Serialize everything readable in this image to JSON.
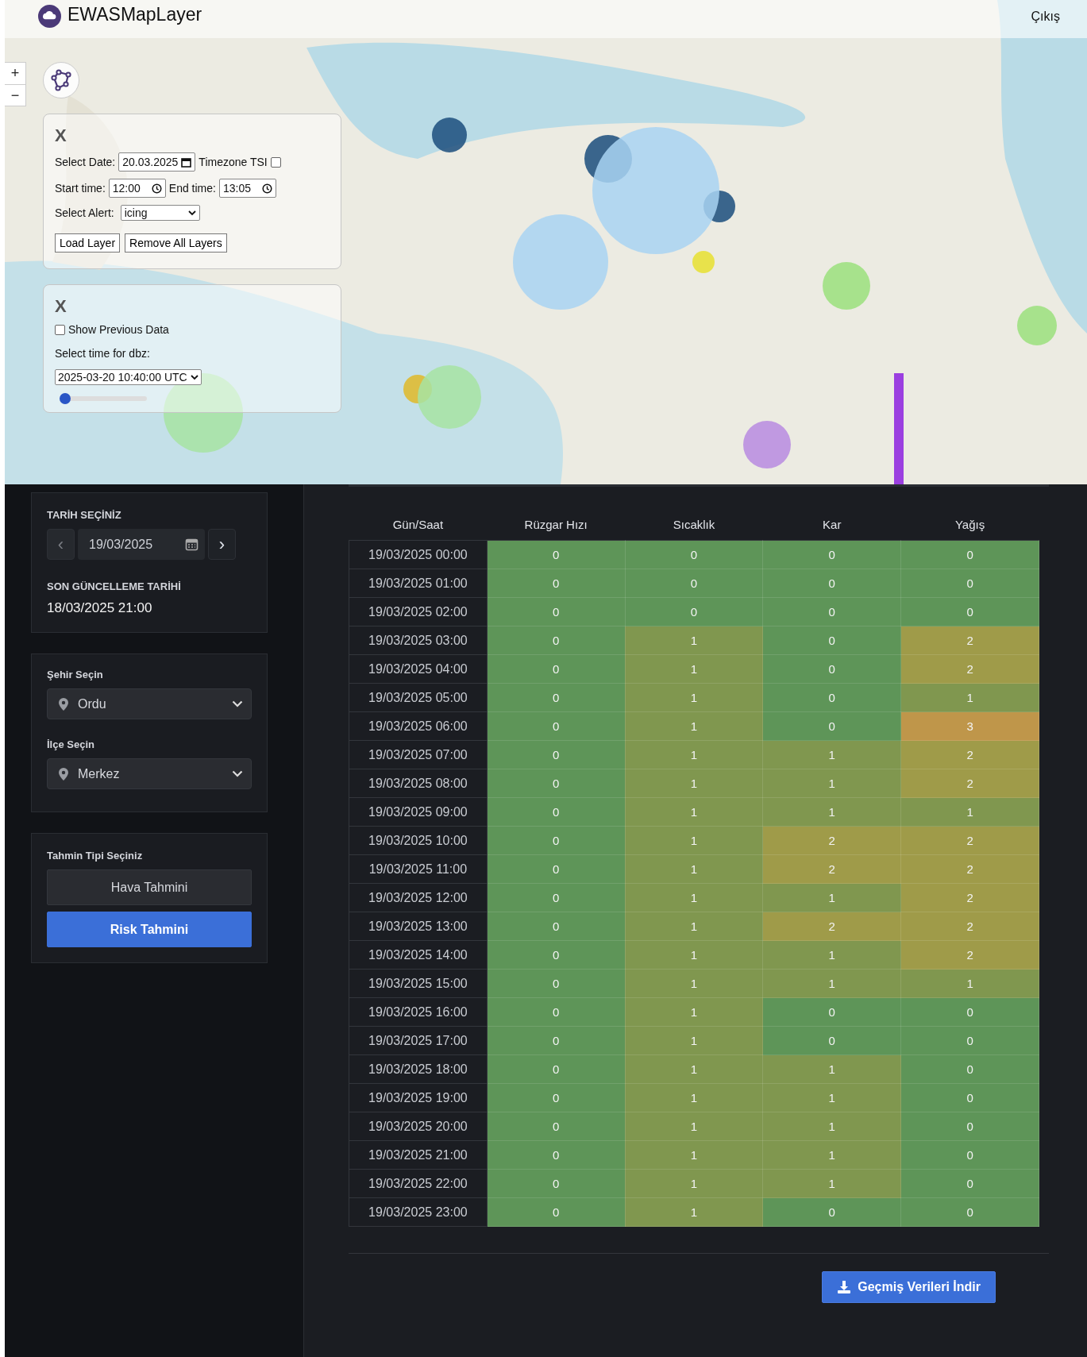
{
  "header": {
    "title": "EWASMapLayer",
    "logout": "Çıkış"
  },
  "map": {
    "kind": "picture",
    "zoom_in": "+",
    "zoom_out": "−"
  },
  "layer_panel": {
    "close": "X",
    "date_label": "Select Date:",
    "date_value": "20.03.2025",
    "timezone_label": "Timezone TSI",
    "timezone_checked": false,
    "start_label": "Start time:",
    "start_value": "12:00",
    "end_label": "End time:",
    "end_value": "13:05",
    "alert_label": "Select Alert:",
    "alert_value": "icing",
    "buttons": [
      "Load Layer",
      "Remove All Layers"
    ]
  },
  "dbz_panel": {
    "close": "X",
    "previous_label": "Show Previous Data",
    "previous_checked": false,
    "time_label": "Select time for dbz:",
    "time_value": "2025-03-20 10:40:00 UTC",
    "level": 0
  },
  "sidebar": {
    "date_title": "TARİH SEÇİNİZ",
    "prev": "‹",
    "date_value": "19/03/2025",
    "next": "›",
    "update_title": "SON GÜNCELLEME TARİHİ",
    "update_value": "18/03/2025 21:00",
    "city_label": "Şehir Seçin",
    "city_value": "Ordu",
    "district_label": "İlçe Seçin",
    "district_value": "Merkez",
    "type_title": "Tahmin Tipi Seçiniz",
    "types": [
      {
        "label": "Hava Tahmini",
        "selected": false
      },
      {
        "label": "Risk Tahmini",
        "selected": true
      }
    ]
  },
  "table": {
    "columns": [
      "Gün/Saat",
      "Rüzgar Hızı",
      "Sıcaklık",
      "Kar",
      "Yağış"
    ],
    "rows": [
      {
        "cells": [
          {
            "value": "19/03/2025 00:00"
          },
          {
            "value": "0",
            "color": "#5e9558"
          },
          {
            "value": "0",
            "color": "#5e9558"
          },
          {
            "value": "0",
            "color": "#5e9558"
          },
          {
            "value": "0",
            "color": "#5e9558"
          }
        ]
      },
      {
        "cells": [
          {
            "value": "19/03/2025 01:00"
          },
          {
            "value": "0",
            "color": "#5e9558"
          },
          {
            "value": "0",
            "color": "#5e9558"
          },
          {
            "value": "0",
            "color": "#5e9558"
          },
          {
            "value": "0",
            "color": "#5e9558"
          }
        ]
      },
      {
        "cells": [
          {
            "value": "19/03/2025 02:00"
          },
          {
            "value": "0",
            "color": "#5e9558"
          },
          {
            "value": "0",
            "color": "#5e9558"
          },
          {
            "value": "0",
            "color": "#5e9558"
          },
          {
            "value": "0",
            "color": "#5e9558"
          }
        ]
      },
      {
        "cells": [
          {
            "value": "19/03/2025 03:00"
          },
          {
            "value": "0",
            "color": "#5e9558"
          },
          {
            "value": "1",
            "color": "#80974f"
          },
          {
            "value": "0",
            "color": "#5e9558"
          },
          {
            "value": "2",
            "color": "#9f9b49"
          }
        ]
      },
      {
        "cells": [
          {
            "value": "19/03/2025 04:00"
          },
          {
            "value": "0",
            "color": "#5e9558"
          },
          {
            "value": "1",
            "color": "#80974f"
          },
          {
            "value": "0",
            "color": "#5e9558"
          },
          {
            "value": "2",
            "color": "#9f9b49"
          }
        ]
      },
      {
        "cells": [
          {
            "value": "19/03/2025 05:00"
          },
          {
            "value": "0",
            "color": "#5e9558"
          },
          {
            "value": "1",
            "color": "#80974f"
          },
          {
            "value": "0",
            "color": "#5e9558"
          },
          {
            "value": "1",
            "color": "#80974f"
          }
        ]
      },
      {
        "cells": [
          {
            "value": "19/03/2025 06:00"
          },
          {
            "value": "0",
            "color": "#5e9558"
          },
          {
            "value": "1",
            "color": "#80974f"
          },
          {
            "value": "0",
            "color": "#5e9558"
          },
          {
            "value": "3",
            "color": "#bf964a"
          }
        ]
      },
      {
        "cells": [
          {
            "value": "19/03/2025 07:00"
          },
          {
            "value": "0",
            "color": "#5e9558"
          },
          {
            "value": "1",
            "color": "#80974f"
          },
          {
            "value": "1",
            "color": "#80974f"
          },
          {
            "value": "2",
            "color": "#9f9b49"
          }
        ]
      },
      {
        "cells": [
          {
            "value": "19/03/2025 08:00"
          },
          {
            "value": "0",
            "color": "#5e9558"
          },
          {
            "value": "1",
            "color": "#80974f"
          },
          {
            "value": "1",
            "color": "#80974f"
          },
          {
            "value": "2",
            "color": "#9f9b49"
          }
        ]
      },
      {
        "cells": [
          {
            "value": "19/03/2025 09:00"
          },
          {
            "value": "0",
            "color": "#5e9558"
          },
          {
            "value": "1",
            "color": "#80974f"
          },
          {
            "value": "1",
            "color": "#80974f"
          },
          {
            "value": "1",
            "color": "#80974f"
          }
        ]
      },
      {
        "cells": [
          {
            "value": "19/03/2025 10:00"
          },
          {
            "value": "0",
            "color": "#5e9558"
          },
          {
            "value": "1",
            "color": "#80974f"
          },
          {
            "value": "2",
            "color": "#9f9b49"
          },
          {
            "value": "2",
            "color": "#9f9b49"
          }
        ]
      },
      {
        "cells": [
          {
            "value": "19/03/2025 11:00"
          },
          {
            "value": "0",
            "color": "#5e9558"
          },
          {
            "value": "1",
            "color": "#80974f"
          },
          {
            "value": "2",
            "color": "#9f9b49"
          },
          {
            "value": "2",
            "color": "#9f9b49"
          }
        ]
      },
      {
        "cells": [
          {
            "value": "19/03/2025 12:00"
          },
          {
            "value": "0",
            "color": "#5e9558"
          },
          {
            "value": "1",
            "color": "#80974f"
          },
          {
            "value": "1",
            "color": "#80974f"
          },
          {
            "value": "2",
            "color": "#9f9b49"
          }
        ]
      },
      {
        "cells": [
          {
            "value": "19/03/2025 13:00"
          },
          {
            "value": "0",
            "color": "#5e9558"
          },
          {
            "value": "1",
            "color": "#80974f"
          },
          {
            "value": "2",
            "color": "#9f9b49"
          },
          {
            "value": "2",
            "color": "#9f9b49"
          }
        ]
      },
      {
        "cells": [
          {
            "value": "19/03/2025 14:00"
          },
          {
            "value": "0",
            "color": "#5e9558"
          },
          {
            "value": "1",
            "color": "#80974f"
          },
          {
            "value": "1",
            "color": "#80974f"
          },
          {
            "value": "2",
            "color": "#9f9b49"
          }
        ]
      },
      {
        "cells": [
          {
            "value": "19/03/2025 15:00"
          },
          {
            "value": "0",
            "color": "#5e9558"
          },
          {
            "value": "1",
            "color": "#80974f"
          },
          {
            "value": "1",
            "color": "#80974f"
          },
          {
            "value": "1",
            "color": "#80974f"
          }
        ]
      },
      {
        "cells": [
          {
            "value": "19/03/2025 16:00"
          },
          {
            "value": "0",
            "color": "#5e9558"
          },
          {
            "value": "1",
            "color": "#80974f"
          },
          {
            "value": "0",
            "color": "#5e9558"
          },
          {
            "value": "0",
            "color": "#5e9558"
          }
        ]
      },
      {
        "cells": [
          {
            "value": "19/03/2025 17:00"
          },
          {
            "value": "0",
            "color": "#5e9558"
          },
          {
            "value": "1",
            "color": "#80974f"
          },
          {
            "value": "0",
            "color": "#5e9558"
          },
          {
            "value": "0",
            "color": "#5e9558"
          }
        ]
      },
      {
        "cells": [
          {
            "value": "19/03/2025 18:00"
          },
          {
            "value": "0",
            "color": "#5e9558"
          },
          {
            "value": "1",
            "color": "#80974f"
          },
          {
            "value": "1",
            "color": "#80974f"
          },
          {
            "value": "0",
            "color": "#5e9558"
          }
        ]
      },
      {
        "cells": [
          {
            "value": "19/03/2025 19:00"
          },
          {
            "value": "0",
            "color": "#5e9558"
          },
          {
            "value": "1",
            "color": "#80974f"
          },
          {
            "value": "1",
            "color": "#80974f"
          },
          {
            "value": "0",
            "color": "#5e9558"
          }
        ]
      },
      {
        "cells": [
          {
            "value": "19/03/2025 20:00"
          },
          {
            "value": "0",
            "color": "#5e9558"
          },
          {
            "value": "1",
            "color": "#80974f"
          },
          {
            "value": "1",
            "color": "#80974f"
          },
          {
            "value": "0",
            "color": "#5e9558"
          }
        ]
      },
      {
        "cells": [
          {
            "value": "19/03/2025 21:00"
          },
          {
            "value": "0",
            "color": "#5e9558"
          },
          {
            "value": "1",
            "color": "#80974f"
          },
          {
            "value": "1",
            "color": "#80974f"
          },
          {
            "value": "0",
            "color": "#5e9558"
          }
        ]
      },
      {
        "cells": [
          {
            "value": "19/03/2025 22:00"
          },
          {
            "value": "0",
            "color": "#5e9558"
          },
          {
            "value": "1",
            "color": "#80974f"
          },
          {
            "value": "1",
            "color": "#80974f"
          },
          {
            "value": "0",
            "color": "#5e9558"
          }
        ]
      },
      {
        "cells": [
          {
            "value": "19/03/2025 23:00"
          },
          {
            "value": "0",
            "color": "#5e9558"
          },
          {
            "value": "1",
            "color": "#80974f"
          },
          {
            "value": "0",
            "color": "#5e9558"
          },
          {
            "value": "0",
            "color": "#5e9558"
          }
        ]
      }
    ]
  },
  "download_button": "Geçmiş Verileri İndir"
}
